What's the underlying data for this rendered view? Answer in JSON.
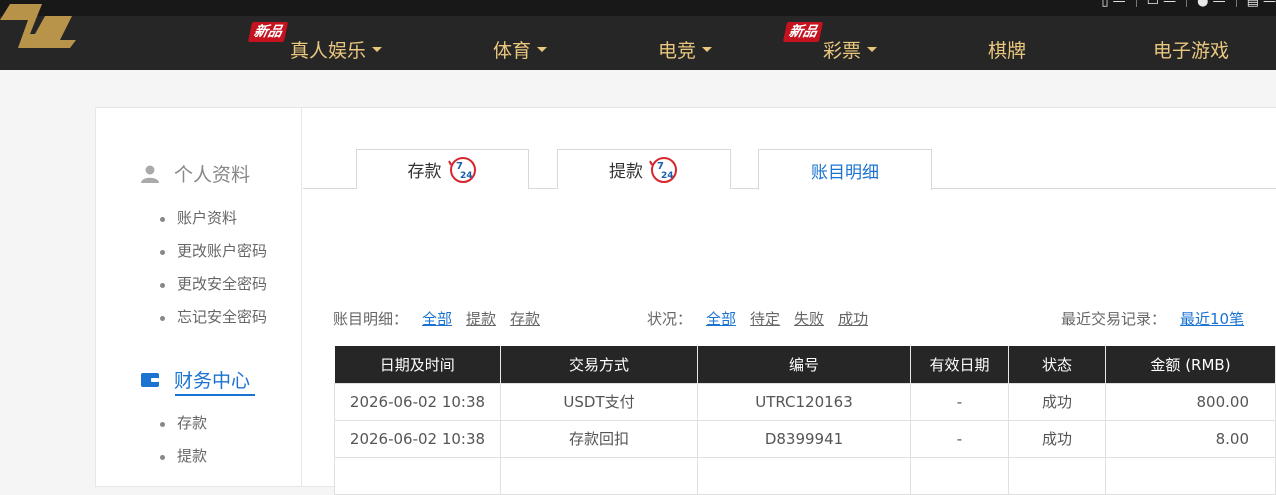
{
  "nav": {
    "items": [
      {
        "label": "真人娱乐",
        "badge": "新品",
        "dropdown": true
      },
      {
        "label": "体育",
        "badge": "",
        "dropdown": true
      },
      {
        "label": "电竞",
        "badge": "",
        "dropdown": true
      },
      {
        "label": "彩票",
        "badge": "新品",
        "dropdown": true
      },
      {
        "label": "棋牌",
        "badge": "",
        "dropdown": false
      },
      {
        "label": "电子游戏",
        "badge": "",
        "dropdown": false
      }
    ],
    "accent_color": "#e9c77e"
  },
  "sidebar": {
    "profile": {
      "title": "个人资料",
      "icon": "user-icon",
      "items": [
        "账户资料",
        "更改账户密码",
        "更改安全密码",
        "忘记安全密码"
      ]
    },
    "finance": {
      "title": "财务中心",
      "icon": "wallet-icon",
      "items": [
        "存款",
        "提款"
      ]
    }
  },
  "tabs": [
    {
      "label": "存款",
      "icon": "7-24-badge-icon"
    },
    {
      "label": "提款",
      "icon": "7-24-badge-icon"
    },
    {
      "label": "账目明细"
    }
  ],
  "badge_text": {
    "top": "7",
    "bottom": "24"
  },
  "filters": {
    "detail_label": "账目明细：",
    "detail_options": [
      "全部",
      "提款",
      "存款"
    ],
    "status_label": "状况：",
    "status_options": [
      "全部",
      "待定",
      "失败",
      "成功"
    ],
    "recent_label": "最近交易记录：",
    "recent_value": "最近10笔"
  },
  "table": {
    "headers": [
      "日期及时间",
      "交易方式",
      "编号",
      "有效日期",
      "状态",
      "金额 (RMB)"
    ],
    "rows": [
      [
        "2026-06-02 10:38",
        "USDT支付",
        "UTRC120163",
        "-",
        "成功",
        "800.00"
      ],
      [
        "2026-06-02 10:38",
        "存款回扣",
        "D8399941",
        "-",
        "成功",
        "8.00"
      ]
    ]
  },
  "colors": {
    "link_active": "#1a73d0",
    "header_bg": "#262626"
  }
}
